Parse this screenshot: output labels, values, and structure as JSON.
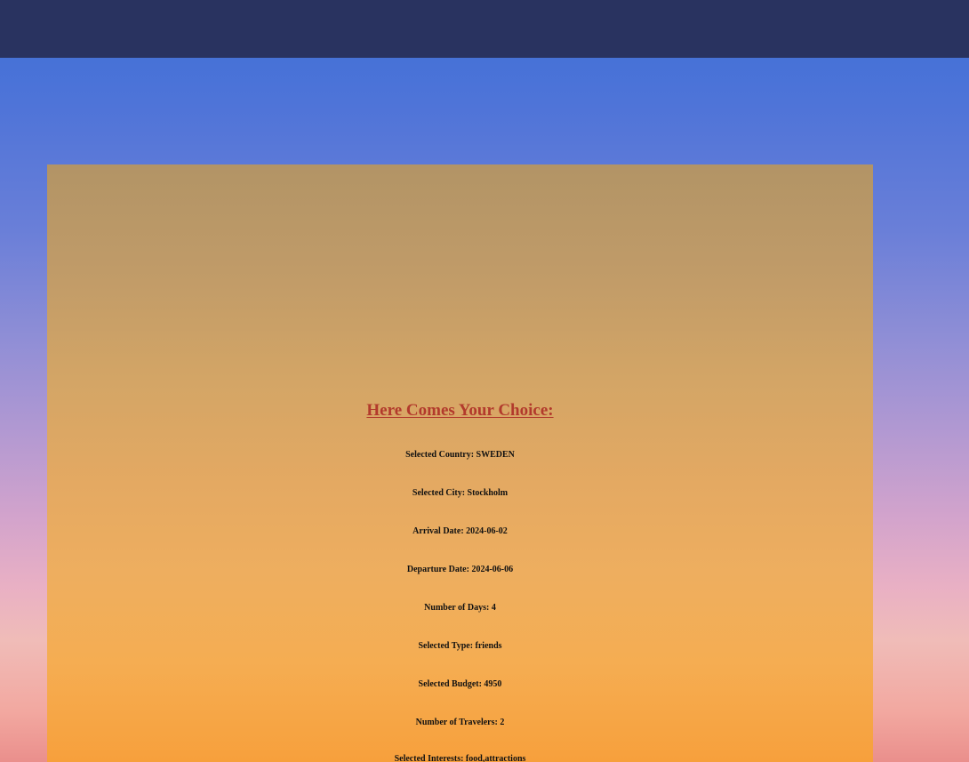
{
  "header": {},
  "choice": {
    "title": "Here Comes Your Choice:",
    "country": "Selected Country: SWEDEN",
    "city": "Selected City: Stockholm",
    "arrival": "Arrival Date: 2024-06-02",
    "departure": "Departure Date: 2024-06-06",
    "days": "Number of Days: 4",
    "type": "Selected Type: friends",
    "budget": "Selected Budget: 4950",
    "travelers": "Number of Travelers: 2",
    "interests": "Selected Interests: food,attractions"
  },
  "colors": {
    "topbar": "#293360",
    "title": "#b23a2c"
  }
}
